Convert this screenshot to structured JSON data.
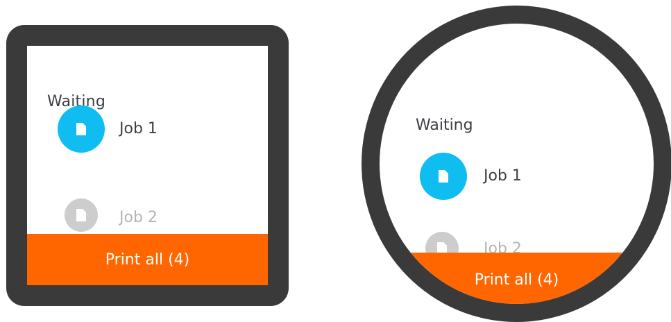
{
  "square_watch": {
    "section_title": "Waiting",
    "jobs": [
      {
        "label": "Job 1",
        "icon": "document-icon",
        "state": "active"
      },
      {
        "label": "Job 2",
        "icon": "document-icon",
        "state": "inactive"
      }
    ],
    "action_button": "Print all (4)"
  },
  "round_watch": {
    "section_title": "Waiting",
    "jobs": [
      {
        "label": "Job 1",
        "icon": "document-icon",
        "state": "active"
      },
      {
        "label": "Job 2",
        "icon": "document-icon",
        "state": "inactive"
      }
    ],
    "action_button": "Print all (4)"
  },
  "colors": {
    "bezel": "#3a3a3a",
    "screen": "#ffffff",
    "active_icon": "#10bdf0",
    "inactive_icon": "#cdcdcd",
    "action": "#ff6600",
    "text_primary": "#3c3f45",
    "text_disabled": "#b4b4b4"
  }
}
